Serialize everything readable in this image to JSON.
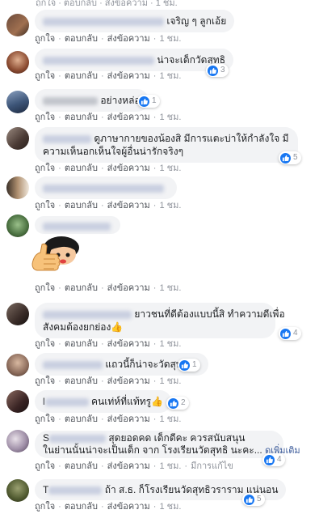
{
  "labels": {
    "like": "ถูกใจ",
    "reply": "ตอบกลับ",
    "message": "ส่งข้อความ",
    "time": "1 ชม.",
    "edited": "มีการแก้ไข",
    "see_more": "ดูเพิ่มเติม",
    "dot": "·"
  },
  "top": {
    "text": "ถูกใจ · ตอบกลับ · ส่งข้อความ · 1 ชม."
  },
  "comments": [
    {
      "text": "เจริญ ๆ ลูกเอ้ย",
      "reactions": ""
    },
    {
      "text": "น่าจะเด็กวัดสุทธิ",
      "reactions": "3"
    },
    {
      "text": "อย่างหล่อ",
      "reactions": "1"
    },
    {
      "line1": "ดูภาษากายของน้องสิ มีการแตะบ่าให้กำลังใจ มี",
      "line2": "ความเห็นอกเห็นใจผู้อื่นน่ารักจริงๆ",
      "reactions": "5"
    },
    {
      "text": "",
      "reactions": ""
    },
    {
      "text": "",
      "reactions": "",
      "sticker": "thumbs-up-sticker"
    },
    {
      "line1": "ยาวชนที่ดีต้องแบบนี้สิ ทำความดีเพื่อ",
      "line2": "สังคมต้องยกย่อง",
      "emoji": "👍",
      "reactions": "4"
    },
    {
      "text": "แถวนี้ก็น่าจะวัดสุทธิค่ะ",
      "reactions": "1"
    },
    {
      "text": "คนเท่ห์ที่แท้ทรู",
      "emoji": "👍",
      "reactions": "2"
    },
    {
      "prefix": "S",
      "line1": "สุดยอดคด เด็กดีคะ ควรสนับสนุน",
      "line2": "ในย่านนั้นน่าจะเป็นเด็ก จาก โรงเรียนวัดสุทธิ นะคะ...",
      "reactions": "4"
    },
    {
      "prefix": "T",
      "text": "ถ้า ส.ธ. ก็โรงเรียนวัดสุทธิวราราม แน่นอน",
      "reactions": "5"
    }
  ]
}
